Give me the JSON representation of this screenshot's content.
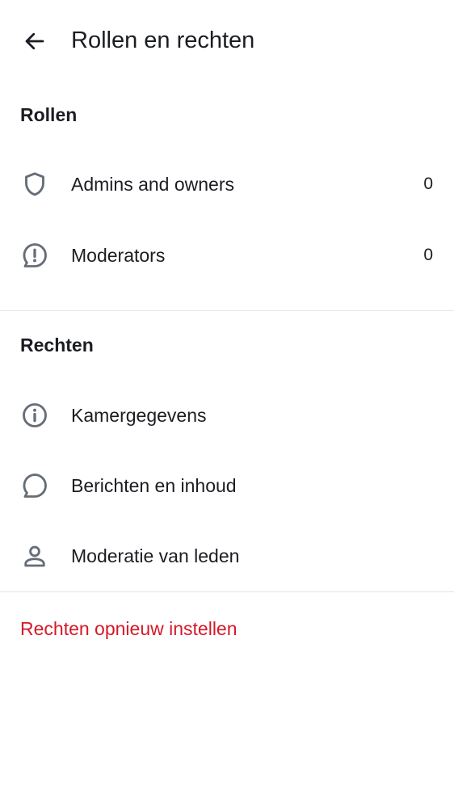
{
  "header": {
    "title": "Rollen en rechten",
    "back_icon": "arrow-left-icon"
  },
  "roles_section": {
    "heading": "Rollen",
    "items": [
      {
        "label": "Admins and owners",
        "count": "0",
        "icon": "shield-icon"
      },
      {
        "label": "Moderators",
        "count": "0",
        "icon": "chat-alert-icon"
      }
    ]
  },
  "permissions_section": {
    "heading": "Rechten",
    "items": [
      {
        "label": "Kamergegevens",
        "icon": "info-icon"
      },
      {
        "label": "Berichten en inhoud",
        "icon": "chat-bubble-icon"
      },
      {
        "label": "Moderatie van leden",
        "icon": "user-icon"
      }
    ]
  },
  "reset": {
    "label": "Rechten opnieuw instellen"
  },
  "colors": {
    "icon": "#656d77",
    "text": "#1b1d22",
    "danger": "#d51928",
    "divider": "#e3e5e8"
  }
}
